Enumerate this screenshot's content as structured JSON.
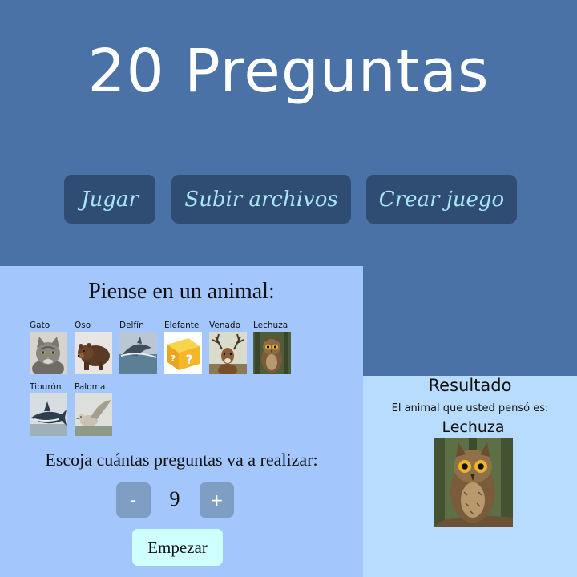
{
  "app": {
    "title": "20 Preguntas"
  },
  "nav": {
    "play_label": "Jugar",
    "upload_label": "Subir archivos",
    "create_label": "Crear juego"
  },
  "game": {
    "prompt": "Piense en un animal:",
    "animals": [
      {
        "label": "Gato",
        "icon": "cat-photo"
      },
      {
        "label": "Oso",
        "icon": "bear-photo"
      },
      {
        "label": "Delfín",
        "icon": "dolphin-photo"
      },
      {
        "label": "Elefante",
        "icon": "question-block-image"
      },
      {
        "label": "Venado",
        "icon": "deer-photo"
      },
      {
        "label": "Lechuza",
        "icon": "owl-photo"
      },
      {
        "label": "Tiburón",
        "icon": "shark-photo"
      },
      {
        "label": "Paloma",
        "icon": "dove-photo"
      }
    ],
    "count_label": "Escoja cuántas preguntas va a realizar:",
    "minus_label": "-",
    "count_value": "9",
    "plus_label": "+",
    "start_label": "Empezar"
  },
  "result": {
    "title": "Resultado",
    "text": "El animal que usted pensó es:",
    "animal": "Lechuza",
    "icon": "owl-photo"
  },
  "colors": {
    "page_bg": "#4a72a6",
    "nav_button_bg": "#2f4d73",
    "nav_button_text": "#a9e6f5",
    "left_panel_bg": "#a3c6fd",
    "right_panel_bg": "#b8dcfd",
    "stepper_bg": "#7e9ec4",
    "start_button_bg": "#cfffff"
  }
}
